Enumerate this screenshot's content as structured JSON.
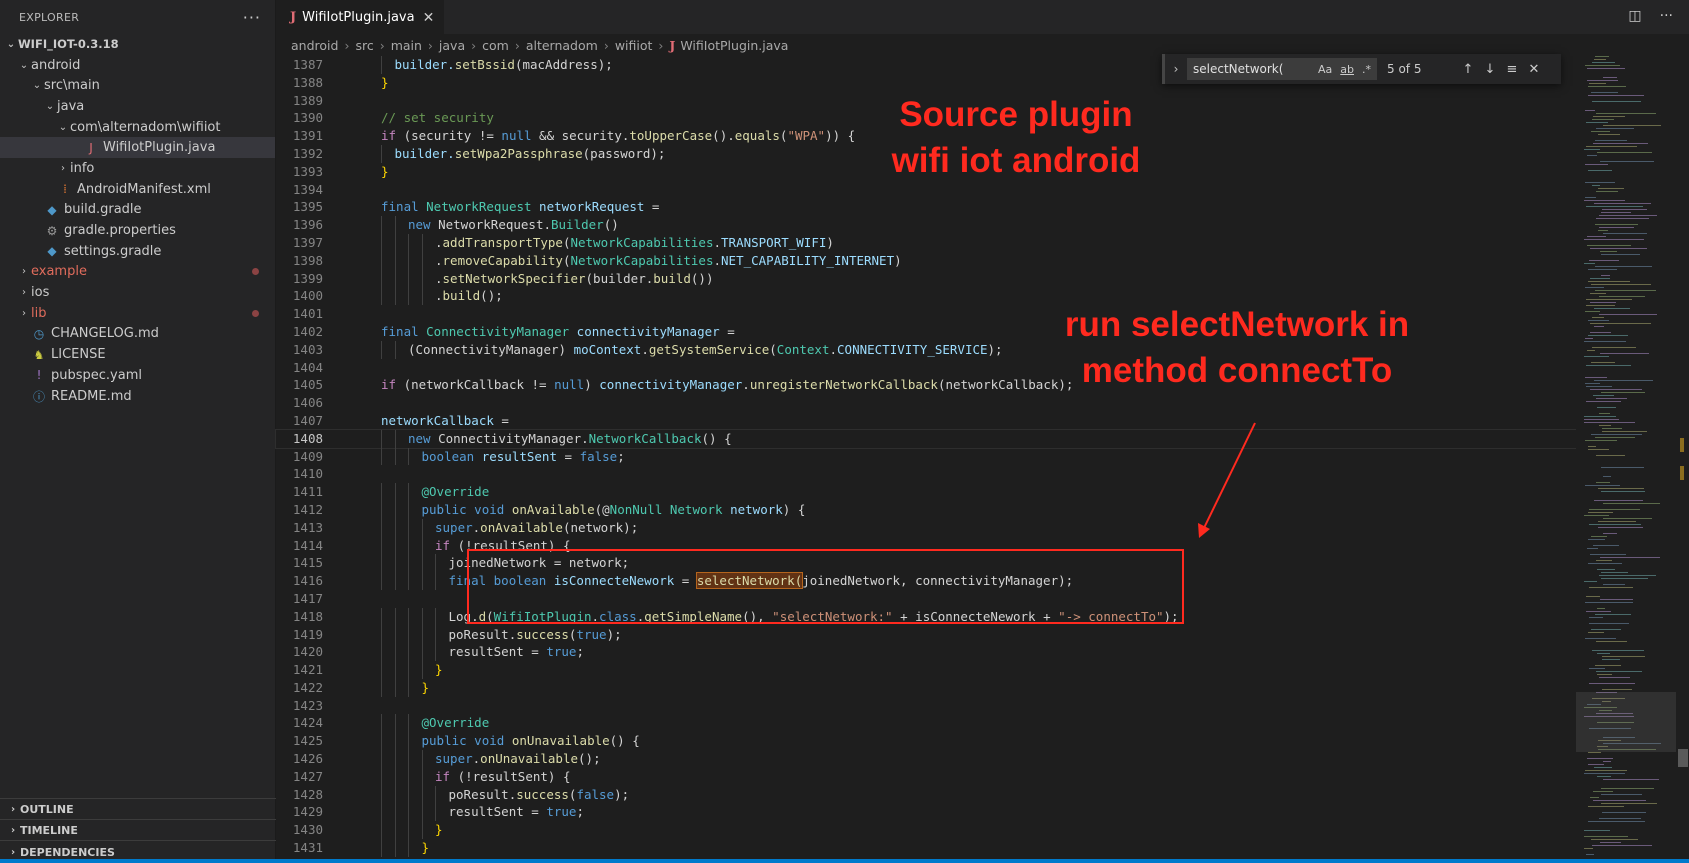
{
  "explorer": {
    "title": "EXPLORER",
    "more": "···",
    "root": "WIFI_IOT-0.3.18",
    "items": [
      {
        "label": "android",
        "depth": 1,
        "chev": "⌄",
        "icon": "",
        "color": "#cccccc",
        "active": false
      },
      {
        "label": "src\\main",
        "depth": 2,
        "chev": "⌄",
        "icon": "",
        "color": "#cccccc",
        "active": false
      },
      {
        "label": "java",
        "depth": 3,
        "chev": "⌄",
        "icon": "",
        "color": "#cccccc",
        "active": false
      },
      {
        "label": "com\\alternadom\\wifiiot",
        "depth": 4,
        "chev": "⌄",
        "icon": "",
        "color": "#cccccc",
        "active": false
      },
      {
        "label": "WifiIotPlugin.java",
        "depth": 5,
        "chev": "",
        "icon": "J",
        "iconColor": "#e06c75",
        "color": "#cccccc",
        "active": true
      },
      {
        "label": "info",
        "depth": 4,
        "chev": "›",
        "icon": "",
        "color": "#cccccc",
        "active": false
      },
      {
        "label": "AndroidManifest.xml",
        "depth": 3,
        "chev": "",
        "icon": "⁞",
        "iconColor": "#e37933",
        "color": "#cccccc",
        "active": false
      },
      {
        "label": "build.gradle",
        "depth": 2,
        "chev": "",
        "icon": "◆",
        "iconColor": "#4e98c9",
        "color": "#cccccc",
        "active": false
      },
      {
        "label": "gradle.properties",
        "depth": 2,
        "chev": "",
        "icon": "⚙",
        "iconColor": "#9a9a9a",
        "color": "#cccccc",
        "active": false
      },
      {
        "label": "settings.gradle",
        "depth": 2,
        "chev": "",
        "icon": "◆",
        "iconColor": "#4e98c9",
        "color": "#cccccc",
        "active": false
      },
      {
        "label": "example",
        "depth": 1,
        "chev": "›",
        "icon": "",
        "color": "#e06c5c",
        "active": false,
        "dot": true
      },
      {
        "label": "ios",
        "depth": 1,
        "chev": "›",
        "icon": "",
        "color": "#cccccc",
        "active": false
      },
      {
        "label": "lib",
        "depth": 1,
        "chev": "›",
        "icon": "",
        "color": "#e06c5c",
        "active": false,
        "dot": true
      },
      {
        "label": "CHANGELOG.md",
        "depth": 1,
        "chev": "",
        "icon": "◷",
        "iconColor": "#4e98c9",
        "color": "#cccccc",
        "active": false
      },
      {
        "label": "LICENSE",
        "depth": 1,
        "chev": "",
        "icon": "♞",
        "iconColor": "#cbcb41",
        "color": "#cccccc",
        "active": false
      },
      {
        "label": "pubspec.yaml",
        "depth": 1,
        "chev": "",
        "icon": "!",
        "iconColor": "#a074c4",
        "color": "#cccccc",
        "active": false
      },
      {
        "label": "README.md",
        "depth": 1,
        "chev": "",
        "icon": "ⓘ",
        "iconColor": "#4e98c9",
        "color": "#cccccc",
        "active": false
      }
    ],
    "sections": [
      "OUTLINE",
      "TIMELINE",
      "DEPENDENCIES"
    ]
  },
  "tab": {
    "label": "WifiIotPlugin.java",
    "icon": "J",
    "close": "✕"
  },
  "breadcrumb": [
    "android",
    "src",
    "main",
    "java",
    "com",
    "alternadom",
    "wifiiot",
    "WifiIotPlugin.java"
  ],
  "find": {
    "query": "selectNetwork(",
    "count": "5 of 5",
    "opt_case": "Aa",
    "opt_word": "ab",
    "opt_regex": ".*"
  },
  "annotations": {
    "top": [
      "Source plugin",
      "wifi iot android"
    ],
    "bottom": [
      "run selectNetwork in",
      "method connectTo"
    ]
  },
  "colors": {
    "annotation": "#ff2a1f",
    "keyword": "#569cd6",
    "control": "#c586c0",
    "function": "#dcdcaa",
    "type": "#4ec9b0",
    "variable": "#9cdcfe",
    "string": "#ce9178",
    "comment": "#6a9955"
  },
  "code": [
    {
      "n": "1387",
      "indent": 1,
      "t": [
        [
          "builder.",
          "v"
        ],
        [
          "setBssid",
          "f"
        ],
        [
          "(macAddress);",
          "p"
        ]
      ]
    },
    {
      "n": "1388",
      "indent": 0,
      "t": [
        [
          "}",
          "y"
        ]
      ]
    },
    {
      "n": "1389",
      "indent": 0,
      "t": []
    },
    {
      "n": "1390",
      "indent": 0,
      "t": [
        [
          "// set security",
          "c"
        ]
      ]
    },
    {
      "n": "1391",
      "indent": 0,
      "t": [
        [
          "if",
          "k2"
        ],
        [
          " (security != ",
          "p"
        ],
        [
          "null",
          "k"
        ],
        [
          " && security.",
          "p"
        ],
        [
          "toUpperCase",
          "f"
        ],
        [
          "().",
          "p"
        ],
        [
          "equals",
          "f"
        ],
        [
          "(",
          "p"
        ],
        [
          "\"WPA\"",
          "s"
        ],
        [
          ")) {",
          "p"
        ]
      ]
    },
    {
      "n": "1392",
      "indent": 1,
      "t": [
        [
          "builder.",
          "v"
        ],
        [
          "setWpa2Passphrase",
          "f"
        ],
        [
          "(password);",
          "p"
        ]
      ]
    },
    {
      "n": "1393",
      "indent": 0,
      "t": [
        [
          "}",
          "y"
        ]
      ]
    },
    {
      "n": "1394",
      "indent": 0,
      "t": []
    },
    {
      "n": "1395",
      "indent": 0,
      "t": [
        [
          "final ",
          "k"
        ],
        [
          "NetworkRequest ",
          "ty"
        ],
        [
          "networkRequest",
          "v"
        ],
        [
          " =",
          "p"
        ]
      ]
    },
    {
      "n": "1396",
      "indent": 2,
      "t": [
        [
          "new ",
          "k"
        ],
        [
          "NetworkRequest.",
          "p"
        ],
        [
          "Builder",
          "ty"
        ],
        [
          "()",
          "p"
        ]
      ]
    },
    {
      "n": "1397",
      "indent": 4,
      "t": [
        [
          ".",
          "p"
        ],
        [
          "addTransportType",
          "f"
        ],
        [
          "(",
          "p"
        ],
        [
          "NetworkCapabilities",
          "ty"
        ],
        [
          ".",
          "p"
        ],
        [
          "TRANSPORT_WIFI",
          "v"
        ],
        [
          ")",
          "p"
        ]
      ]
    },
    {
      "n": "1398",
      "indent": 4,
      "t": [
        [
          ".",
          "p"
        ],
        [
          "removeCapability",
          "f"
        ],
        [
          "(",
          "p"
        ],
        [
          "NetworkCapabilities",
          "ty"
        ],
        [
          ".",
          "p"
        ],
        [
          "NET_CAPABILITY_INTERNET",
          "v"
        ],
        [
          ")",
          "p"
        ]
      ]
    },
    {
      "n": "1399",
      "indent": 4,
      "t": [
        [
          ".",
          "p"
        ],
        [
          "setNetworkSpecifier",
          "f"
        ],
        [
          "(builder.",
          "p"
        ],
        [
          "build",
          "f"
        ],
        [
          "())",
          "p"
        ]
      ]
    },
    {
      "n": "1400",
      "indent": 4,
      "t": [
        [
          ".",
          "p"
        ],
        [
          "build",
          "f"
        ],
        [
          "();",
          "p"
        ]
      ]
    },
    {
      "n": "1401",
      "indent": 0,
      "t": []
    },
    {
      "n": "1402",
      "indent": 0,
      "t": [
        [
          "final ",
          "k"
        ],
        [
          "ConnectivityManager ",
          "ty"
        ],
        [
          "connectivityManager",
          "v"
        ],
        [
          " =",
          "p"
        ]
      ]
    },
    {
      "n": "1403",
      "indent": 2,
      "t": [
        [
          "(ConnectivityManager) ",
          "p"
        ],
        [
          "moContext",
          "v"
        ],
        [
          ".",
          "p"
        ],
        [
          "getSystemService",
          "f"
        ],
        [
          "(",
          "p"
        ],
        [
          "Context",
          "ty"
        ],
        [
          ".",
          "p"
        ],
        [
          "CONNECTIVITY_SERVICE",
          "v"
        ],
        [
          ");",
          "p"
        ]
      ]
    },
    {
      "n": "1404",
      "indent": 0,
      "t": []
    },
    {
      "n": "1405",
      "indent": 0,
      "t": [
        [
          "if",
          "k2"
        ],
        [
          " (networkCallback != ",
          "p"
        ],
        [
          "null",
          "k"
        ],
        [
          ") ",
          "p"
        ],
        [
          "connectivityManager",
          "v"
        ],
        [
          ".",
          "p"
        ],
        [
          "unregisterNetworkCallback",
          "f"
        ],
        [
          "(networkCallback);",
          "p"
        ]
      ]
    },
    {
      "n": "1406",
      "indent": 0,
      "t": []
    },
    {
      "n": "1407",
      "indent": 0,
      "t": [
        [
          "networkCallback",
          "v"
        ],
        [
          " =",
          "p"
        ]
      ]
    },
    {
      "n": "1408",
      "indent": 2,
      "cur": true,
      "t": [
        [
          "new ",
          "k"
        ],
        [
          "ConnectivityManager.",
          "p"
        ],
        [
          "NetworkCallback",
          "ty"
        ],
        [
          "() {",
          "p"
        ]
      ]
    },
    {
      "n": "1409",
      "indent": 3,
      "t": [
        [
          "boolean ",
          "k"
        ],
        [
          "resultSent",
          "v"
        ],
        [
          " = ",
          "p"
        ],
        [
          "false",
          "k"
        ],
        [
          ";",
          "p"
        ]
      ]
    },
    {
      "n": "1410",
      "indent": 0,
      "t": []
    },
    {
      "n": "1411",
      "indent": 3,
      "t": [
        [
          "@Override",
          "ty"
        ]
      ]
    },
    {
      "n": "1412",
      "indent": 3,
      "t": [
        [
          "public void ",
          "k"
        ],
        [
          "onAvailable",
          "f"
        ],
        [
          "(@",
          "p"
        ],
        [
          "NonNull",
          "ty"
        ],
        [
          " Network ",
          "ty"
        ],
        [
          "network",
          "v"
        ],
        [
          ") {",
          "p"
        ]
      ]
    },
    {
      "n": "1413",
      "indent": 4,
      "t": [
        [
          "super",
          "k"
        ],
        [
          ".",
          "p"
        ],
        [
          "onAvailable",
          "f"
        ],
        [
          "(network);",
          "p"
        ]
      ]
    },
    {
      "n": "1414",
      "indent": 4,
      "t": [
        [
          "if",
          "k2"
        ],
        [
          " (!resultSent) {",
          "p"
        ]
      ]
    },
    {
      "n": "1415",
      "indent": 5,
      "t": [
        [
          "joinedNetwork = network;",
          "p"
        ]
      ]
    },
    {
      "n": "1416",
      "indent": 5,
      "t": [
        [
          "final boolean ",
          "k"
        ],
        [
          "isConnecteNework",
          "v"
        ],
        [
          " = ",
          "p"
        ],
        [
          "selectNetwork(",
          "fm"
        ],
        [
          "joinedNetwork, connectivityManager);",
          "p"
        ]
      ]
    },
    {
      "n": "1417",
      "indent": 0,
      "t": []
    },
    {
      "n": "1418",
      "indent": 5,
      "t": [
        [
          "Log.",
          "p"
        ],
        [
          "d",
          "f"
        ],
        [
          "(",
          "p"
        ],
        [
          "WifiIotPlugin",
          "ty"
        ],
        [
          ".",
          "p"
        ],
        [
          "class",
          "k"
        ],
        [
          ".",
          "p"
        ],
        [
          "getSimpleName",
          "f"
        ],
        [
          "(), ",
          "p"
        ],
        [
          "\"selectNetwork:\"",
          "s"
        ],
        [
          " + isConnecteNework + ",
          "p"
        ],
        [
          "\"-> connectTo\"",
          "s"
        ],
        [
          ");",
          "p"
        ]
      ]
    },
    {
      "n": "1419",
      "indent": 5,
      "t": [
        [
          "poResult.",
          "p"
        ],
        [
          "success",
          "f"
        ],
        [
          "(",
          "p"
        ],
        [
          "true",
          "k"
        ],
        [
          ");",
          "p"
        ]
      ]
    },
    {
      "n": "1420",
      "indent": 5,
      "t": [
        [
          "resultSent = ",
          "p"
        ],
        [
          "true",
          "k"
        ],
        [
          ";",
          "p"
        ]
      ]
    },
    {
      "n": "1421",
      "indent": 4,
      "t": [
        [
          "}",
          "y"
        ]
      ]
    },
    {
      "n": "1422",
      "indent": 3,
      "t": [
        [
          "}",
          "y"
        ]
      ]
    },
    {
      "n": "1423",
      "indent": 0,
      "t": []
    },
    {
      "n": "1424",
      "indent": 3,
      "t": [
        [
          "@Override",
          "ty"
        ]
      ]
    },
    {
      "n": "1425",
      "indent": 3,
      "t": [
        [
          "public void ",
          "k"
        ],
        [
          "onUnavailable",
          "f"
        ],
        [
          "() {",
          "p"
        ]
      ]
    },
    {
      "n": "1426",
      "indent": 4,
      "t": [
        [
          "super",
          "k"
        ],
        [
          ".",
          "p"
        ],
        [
          "onUnavailable",
          "f"
        ],
        [
          "();",
          "p"
        ]
      ]
    },
    {
      "n": "1427",
      "indent": 4,
      "t": [
        [
          "if",
          "k2"
        ],
        [
          " (!resultSent) {",
          "p"
        ]
      ]
    },
    {
      "n": "1428",
      "indent": 5,
      "t": [
        [
          "poResult.",
          "p"
        ],
        [
          "success",
          "f"
        ],
        [
          "(",
          "p"
        ],
        [
          "false",
          "k"
        ],
        [
          ");",
          "p"
        ]
      ]
    },
    {
      "n": "1429",
      "indent": 5,
      "t": [
        [
          "resultSent = ",
          "p"
        ],
        [
          "true",
          "k"
        ],
        [
          ";",
          "p"
        ]
      ]
    },
    {
      "n": "1430",
      "indent": 4,
      "t": [
        [
          "}",
          "y"
        ]
      ]
    },
    {
      "n": "1431",
      "indent": 3,
      "t": [
        [
          "}",
          "y"
        ]
      ]
    }
  ]
}
